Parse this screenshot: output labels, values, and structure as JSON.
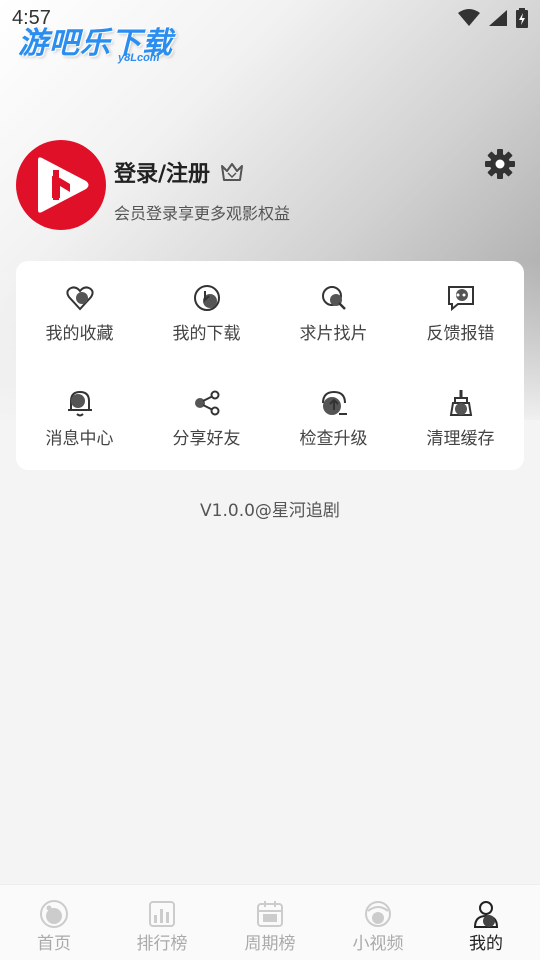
{
  "status_bar": {
    "time": "4:57"
  },
  "watermark": {
    "title": "游吧乐下载",
    "subtitle": "y8Lcom"
  },
  "profile": {
    "login_label": "登录/注册",
    "subtitle": "会员登录享更多观影权益"
  },
  "menu": {
    "items": [
      {
        "label": "我的收藏",
        "icon": "heart-icon"
      },
      {
        "label": "我的下载",
        "icon": "download-icon"
      },
      {
        "label": "求片找片",
        "icon": "search-film-icon"
      },
      {
        "label": "反馈报错",
        "icon": "feedback-icon"
      },
      {
        "label": "消息中心",
        "icon": "bell-icon"
      },
      {
        "label": "分享好友",
        "icon": "share-icon"
      },
      {
        "label": "检查升级",
        "icon": "upgrade-icon"
      },
      {
        "label": "清理缓存",
        "icon": "broom-icon"
      }
    ]
  },
  "version": "V1.0.0@星河追剧",
  "bottom_nav": {
    "items": [
      {
        "label": "首页",
        "icon": "home-icon"
      },
      {
        "label": "排行榜",
        "icon": "ranking-icon"
      },
      {
        "label": "周期榜",
        "icon": "calendar-icon"
      },
      {
        "label": "小视频",
        "icon": "short-video-icon"
      },
      {
        "label": "我的",
        "icon": "profile-icon"
      }
    ],
    "active": "我的"
  },
  "colors": {
    "brand_red": "#e01028",
    "watermark_blue": "#2a8ef0"
  }
}
